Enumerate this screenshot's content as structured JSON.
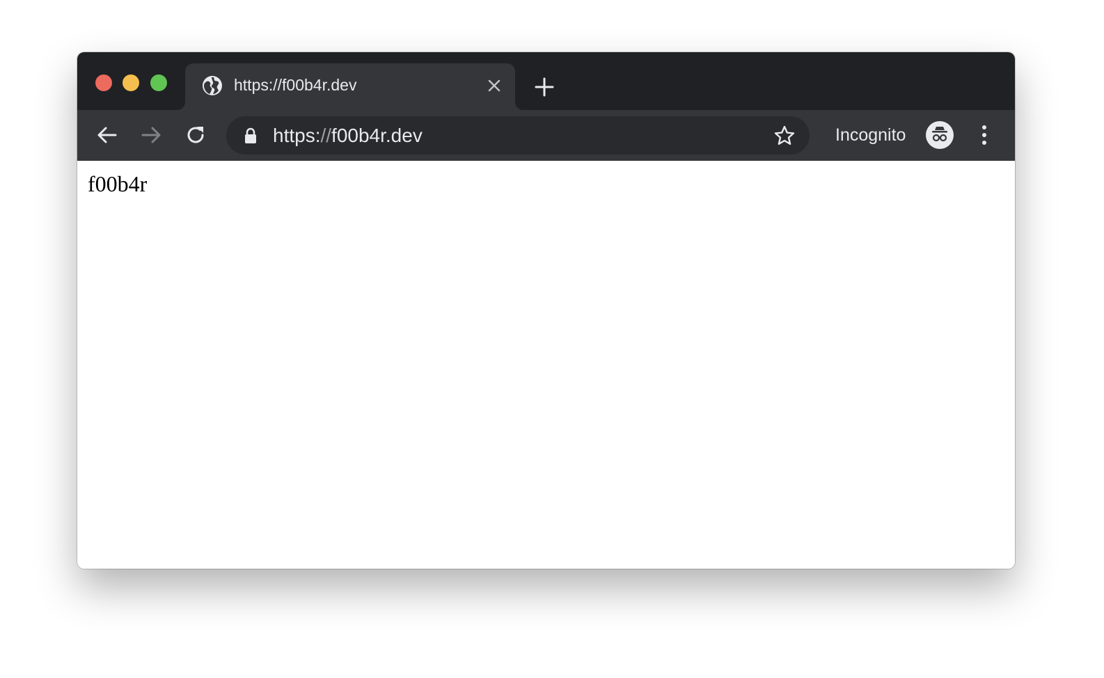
{
  "window": {
    "colors": {
      "frame": "#202124",
      "toolbar": "#35363a",
      "omnibox": "#292a2d",
      "text": "#e8eaed",
      "close": "#ed6a5e",
      "minimize": "#f5bf4f",
      "maximize": "#61c554"
    }
  },
  "tab": {
    "title": "https://f00b4r.dev",
    "favicon_icon": "globe-icon",
    "close_icon": "close-icon"
  },
  "new_tab_icon": "plus-icon",
  "toolbar": {
    "back_icon": "arrow-left-icon",
    "forward_icon": "arrow-right-icon",
    "reload_icon": "reload-icon",
    "omnibox": {
      "lock_icon": "lock-icon",
      "url_scheme": "https:",
      "url_slashes": "//",
      "url_host": "f00b4r.dev",
      "bookmark_icon": "star-icon"
    },
    "incognito_label": "Incognito",
    "incognito_icon": "incognito-icon",
    "menu_icon": "more-vert-icon"
  },
  "page": {
    "body_text": "f00b4r"
  }
}
